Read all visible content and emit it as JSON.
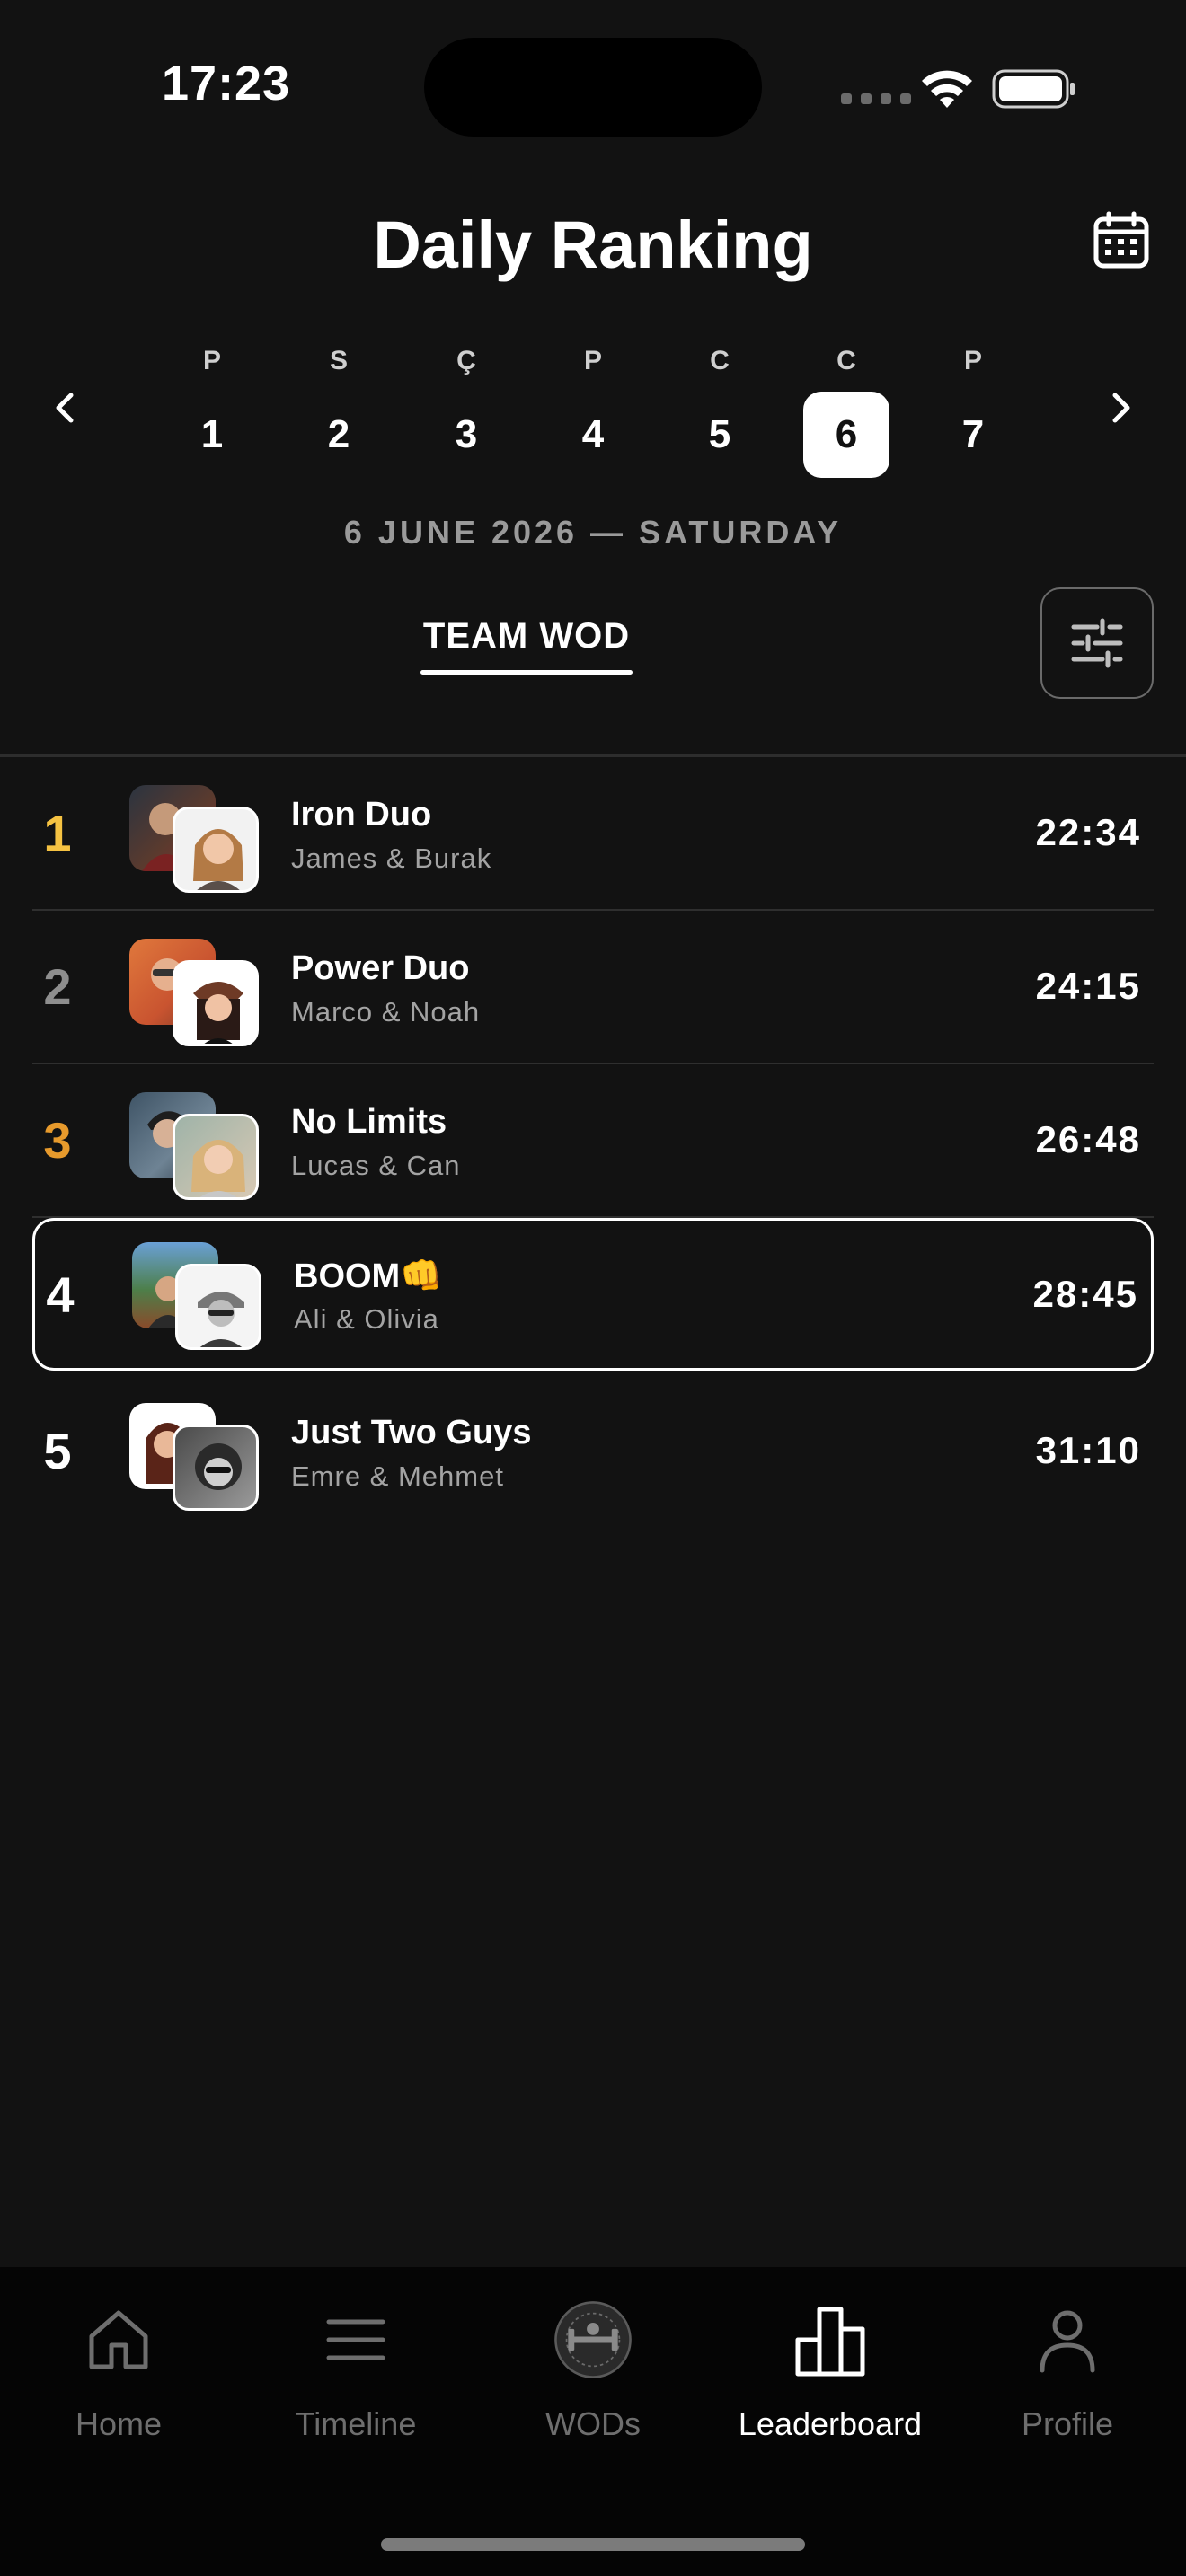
{
  "status_bar": {
    "time": "17:23"
  },
  "header": {
    "title": "Daily Ranking"
  },
  "week": {
    "days": [
      {
        "letter": "P",
        "number": "1",
        "active": false
      },
      {
        "letter": "S",
        "number": "2",
        "active": false
      },
      {
        "letter": "Ç",
        "number": "3",
        "active": false
      },
      {
        "letter": "P",
        "number": "4",
        "active": false
      },
      {
        "letter": "C",
        "number": "5",
        "active": false
      },
      {
        "letter": "C",
        "number": "6",
        "active": true
      },
      {
        "letter": "P",
        "number": "7",
        "active": false
      }
    ],
    "selected_date": "6 JUNE 2026 — SATURDAY"
  },
  "tabs": {
    "active_label": "TEAM WOD"
  },
  "ranking": [
    {
      "rank": "1",
      "name": "Iron Duo",
      "members": "James & Burak",
      "score": "22:34",
      "rank_color": "#f5c242",
      "highlight": false
    },
    {
      "rank": "2",
      "name": "Power Duo",
      "members": "Marco & Noah",
      "score": "24:15",
      "rank_color": "#8e8e8e",
      "highlight": false
    },
    {
      "rank": "3",
      "name": "No Limits",
      "members": "Lucas & Can",
      "score": "26:48",
      "rank_color": "#e79a2c",
      "highlight": false
    },
    {
      "rank": "4",
      "name": "BOOM👊",
      "members": "Ali & Olivia",
      "score": "28:45",
      "rank_color": "#ffffff",
      "highlight": true
    },
    {
      "rank": "5",
      "name": "Just Two Guys",
      "members": "Emre & Mehmet",
      "score": "31:10",
      "rank_color": "#ffffff",
      "highlight": false
    }
  ],
  "tabbar": {
    "items": [
      {
        "label": "Home",
        "icon": "home-icon",
        "active": false
      },
      {
        "label": "Timeline",
        "icon": "menu-lines-icon",
        "active": false
      },
      {
        "label": "WODs",
        "icon": "gym-logo-icon",
        "active": false
      },
      {
        "label": "Leaderboard",
        "icon": "podium-icon",
        "active": true
      },
      {
        "label": "Profile",
        "icon": "person-icon",
        "active": false
      }
    ]
  }
}
